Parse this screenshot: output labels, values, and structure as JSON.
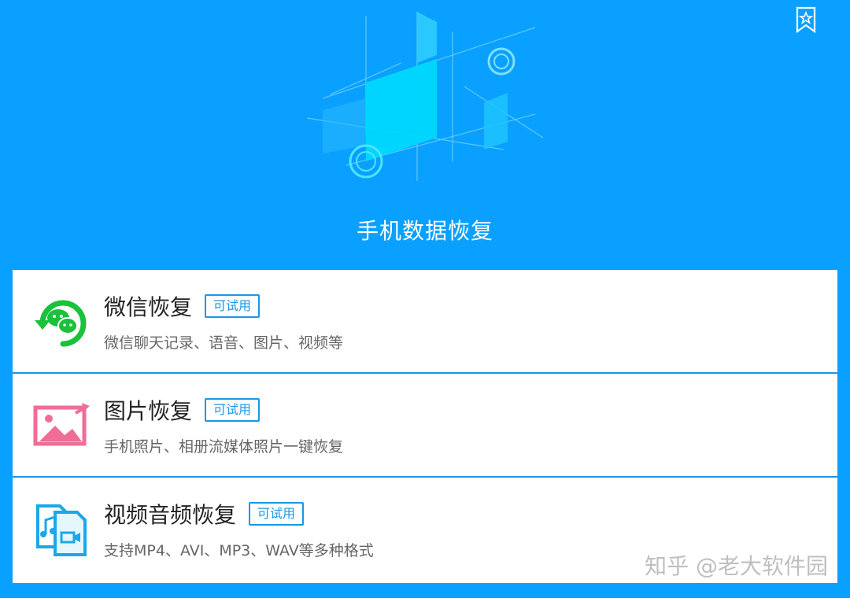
{
  "header": {
    "title": "手机数据恢复",
    "bookmark_icon": "star-bookmark-icon"
  },
  "cards": [
    {
      "title": "微信恢复",
      "badge": "可试用",
      "desc": "微信聊天记录、语音、图片、视频等",
      "icon": "wechat-recovery-icon"
    },
    {
      "title": "图片恢复",
      "badge": "可试用",
      "desc": "手机照片、相册流媒体照片一键恢复",
      "icon": "image-recovery-icon"
    },
    {
      "title": "视频音频恢复",
      "badge": "可试用",
      "desc": "支持MP4、AVI、MP3、WAV等多种格式",
      "icon": "media-files-icon"
    }
  ],
  "watermark": "知乎 @老大软件园",
  "colors": {
    "background": "#0aa0ff",
    "accent": "#1a97e6",
    "wechat_green": "#19c23a",
    "image_pink": "#f06e96"
  }
}
